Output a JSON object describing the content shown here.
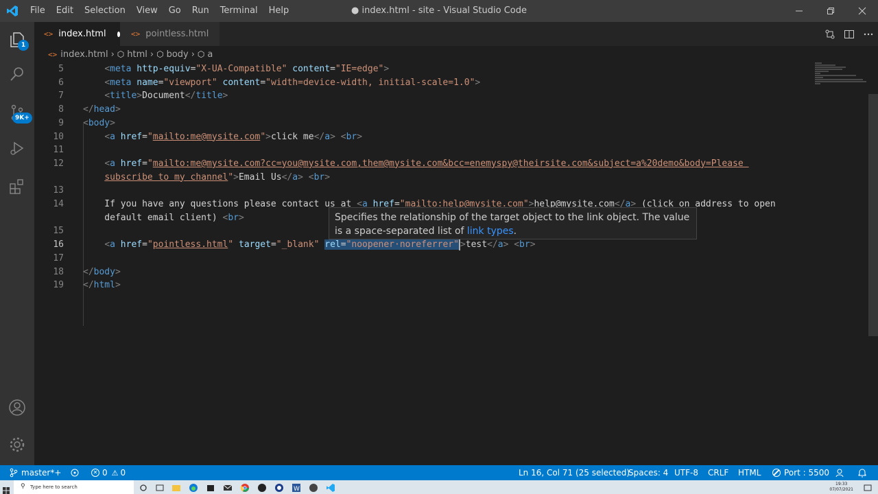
{
  "window": {
    "title": "● index.html - site - Visual Studio Code",
    "menu": [
      "File",
      "Edit",
      "Selection",
      "View",
      "Go",
      "Run",
      "Terminal",
      "Help"
    ]
  },
  "activity_bar": {
    "explorer_badge": "1",
    "source_control_badge": "9K+"
  },
  "tabs": [
    {
      "label": "index.html",
      "icon": "<>",
      "active": true,
      "modified": true
    },
    {
      "label": "pointless.html",
      "icon": "<>",
      "active": false,
      "modified": false
    }
  ],
  "breadcrumb": {
    "file": "index.html",
    "items": [
      "html",
      "body",
      "a"
    ]
  },
  "editor": {
    "lines": [
      {
        "n": "5"
      },
      {
        "n": "6"
      },
      {
        "n": "7"
      },
      {
        "n": "8"
      },
      {
        "n": "9"
      },
      {
        "n": "10"
      },
      {
        "n": "11"
      },
      {
        "n": "12"
      },
      {
        "n": ""
      },
      {
        "n": "13"
      },
      {
        "n": "14"
      },
      {
        "n": ""
      },
      {
        "n": "15"
      },
      {
        "n": "16"
      },
      {
        "n": "17"
      },
      {
        "n": "18"
      },
      {
        "n": "19"
      }
    ]
  },
  "hover": {
    "text_before": "Specifies the relationship of the target object to the link object. The value is a space-separated list of ",
    "link_text": "link types",
    "text_after": "."
  },
  "statusbar": {
    "branch": "master*+",
    "errors": "0",
    "warnings": "0",
    "position": "Ln 16, Col 71 (25 selected)",
    "spaces": "Spaces: 4",
    "encoding": "UTF-8",
    "eol": "CRLF",
    "language": "HTML",
    "port": "Port : 5500"
  },
  "taskbar": {
    "search_placeholder": "Type here to search",
    "time": "19:33",
    "date": "07/07/2021"
  },
  "colors": {
    "accent": "#007acc",
    "tag": "#569cd6",
    "attribute": "#9cdcfe",
    "string": "#ce9178",
    "selection": "#264f78"
  }
}
